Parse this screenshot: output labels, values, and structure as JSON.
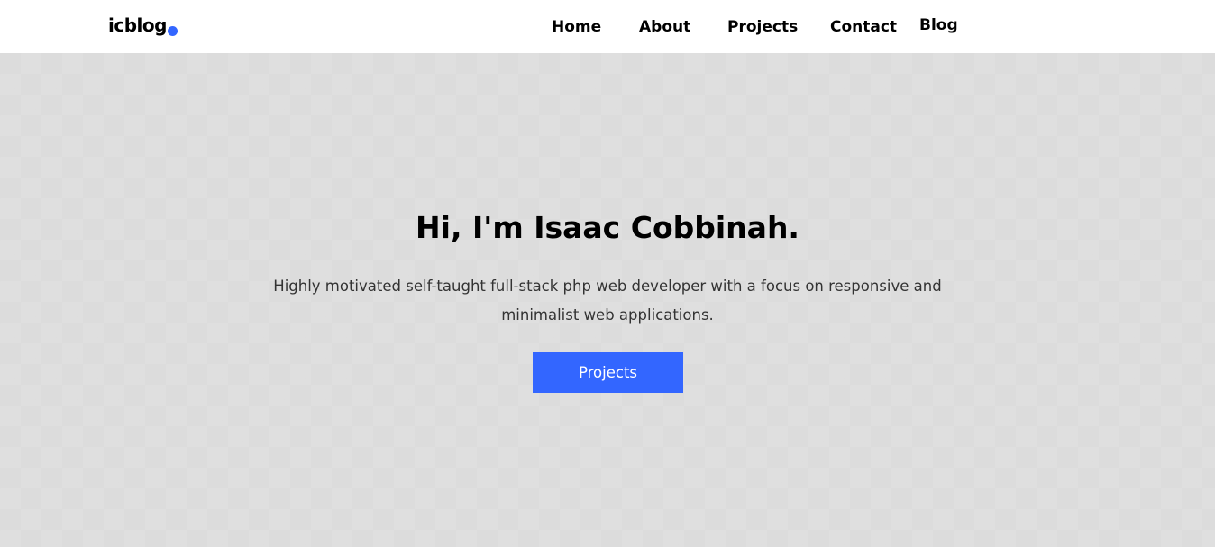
{
  "colors": {
    "accent": "#3366ff",
    "nav_background": "#ffffff",
    "hero_background": "#dcdcdc"
  },
  "header": {
    "logo_text": "icblog",
    "nav": [
      {
        "label": "Home"
      },
      {
        "label": "About"
      },
      {
        "label": "Projects"
      },
      {
        "label": "Contact"
      },
      {
        "label": "Blog"
      }
    ]
  },
  "hero": {
    "title": "Hi, I'm Isaac Cobbinah.",
    "description": "Highly motivated self-taught full-stack php web developer with a focus on responsive and minimalist web applications.",
    "button_label": "Projects"
  }
}
